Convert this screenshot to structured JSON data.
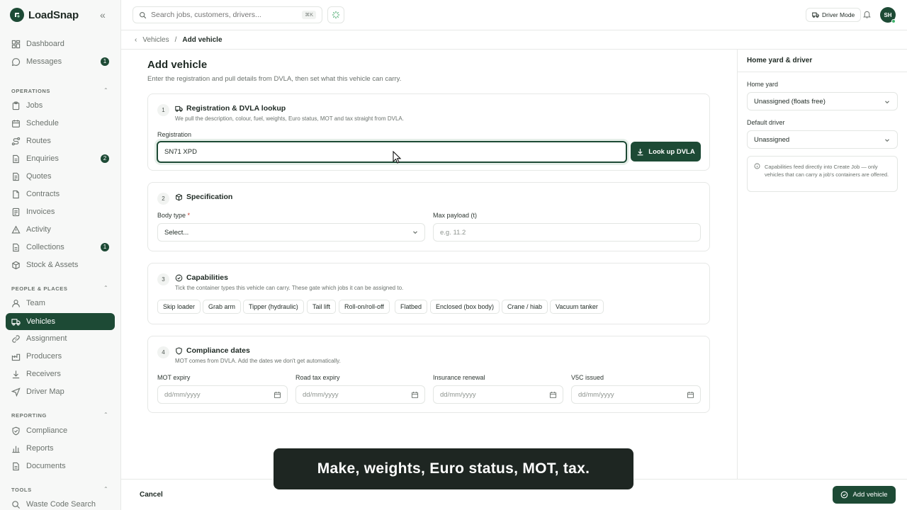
{
  "app": {
    "name": "LoadSnap"
  },
  "sidebar": {
    "top_items": [
      {
        "label": "Dashboard"
      },
      {
        "label": "Messages",
        "badge": "1"
      }
    ],
    "sections": [
      {
        "title": "OPERATIONS",
        "items": [
          {
            "label": "Jobs"
          },
          {
            "label": "Schedule"
          },
          {
            "label": "Routes"
          },
          {
            "label": "Enquiries",
            "badge": "2"
          },
          {
            "label": "Quotes"
          },
          {
            "label": "Contracts"
          },
          {
            "label": "Invoices"
          },
          {
            "label": "Activity"
          },
          {
            "label": "Collections",
            "badge": "1"
          },
          {
            "label": "Stock & Assets"
          }
        ]
      },
      {
        "title": "PEOPLE & PLACES",
        "items": [
          {
            "label": "Team"
          },
          {
            "label": "Vehicles",
            "active": true
          },
          {
            "label": "Assignment"
          },
          {
            "label": "Producers"
          },
          {
            "label": "Receivers"
          },
          {
            "label": "Driver Map"
          }
        ]
      },
      {
        "title": "REPORTING",
        "items": [
          {
            "label": "Compliance"
          },
          {
            "label": "Reports"
          },
          {
            "label": "Documents"
          }
        ]
      },
      {
        "title": "TOOLS",
        "items": [
          {
            "label": "Waste Code Search"
          }
        ]
      }
    ]
  },
  "topbar": {
    "search_placeholder": "Search jobs, customers, drivers...",
    "search_shortcut": "⌘K",
    "driver_mode_label": "Driver Mode",
    "avatar_initials": "SH"
  },
  "breadcrumb": {
    "parent": "Vehicles",
    "separator": "/",
    "current": "Add vehicle"
  },
  "page": {
    "title": "Add vehicle",
    "subtitle": "Enter the registration and pull details from DVLA, then set what this vehicle can carry."
  },
  "registration_card": {
    "step": "1",
    "title": "Registration & DVLA lookup",
    "description": "We pull the description, colour, fuel, weights, Euro status, MOT and tax straight from DVLA.",
    "field_label": "Registration",
    "field_value": "SN71 XPD",
    "lookup_button": "Look up DVLA"
  },
  "specification_card": {
    "step": "2",
    "title": "Specification",
    "body_type_label": "Body type",
    "required_mark": "*",
    "body_type_value": "Select...",
    "payload_label": "Max payload (t)",
    "payload_placeholder": "e.g. 11.2"
  },
  "capabilities_card": {
    "step": "3",
    "title": "Capabilities",
    "description": "Tick the container types this vehicle can carry. These gate which jobs it can be assigned to.",
    "chips": [
      "Skip loader",
      "Grab arm",
      "Tipper (hydraulic)",
      "Tail lift",
      "Roll-on/roll-off",
      "Flatbed",
      "Enclosed (box body)",
      "Crane / hiab",
      "Vacuum tanker"
    ]
  },
  "compliance_card": {
    "step": "4",
    "title": "Compliance dates",
    "description": "MOT comes from DVLA. Add the dates we don't get automatically.",
    "fields": [
      {
        "label": "MOT expiry",
        "placeholder": "dd/mm/yyyy"
      },
      {
        "label": "Road tax expiry",
        "placeholder": "dd/mm/yyyy"
      },
      {
        "label": "Insurance renewal",
        "placeholder": "dd/mm/yyyy"
      },
      {
        "label": "V5C issued",
        "placeholder": "dd/mm/yyyy"
      }
    ]
  },
  "right_panel": {
    "title": "Home yard & driver",
    "home_yard_label": "Home yard",
    "home_yard_value": "Unassigned (floats free)",
    "default_driver_label": "Default driver",
    "default_driver_value": "Unassigned",
    "note": "Capabilities feed directly into Create Job — only vehicles that can carry a job's containers are offered."
  },
  "footer": {
    "cancel_label": "Cancel",
    "submit_label": "Add vehicle"
  },
  "caption": "Make, weights, Euro status, MOT, tax.",
  "colors": {
    "brand": "#1d4a35",
    "badge": "#1d4a35",
    "required": "#c0392b"
  }
}
